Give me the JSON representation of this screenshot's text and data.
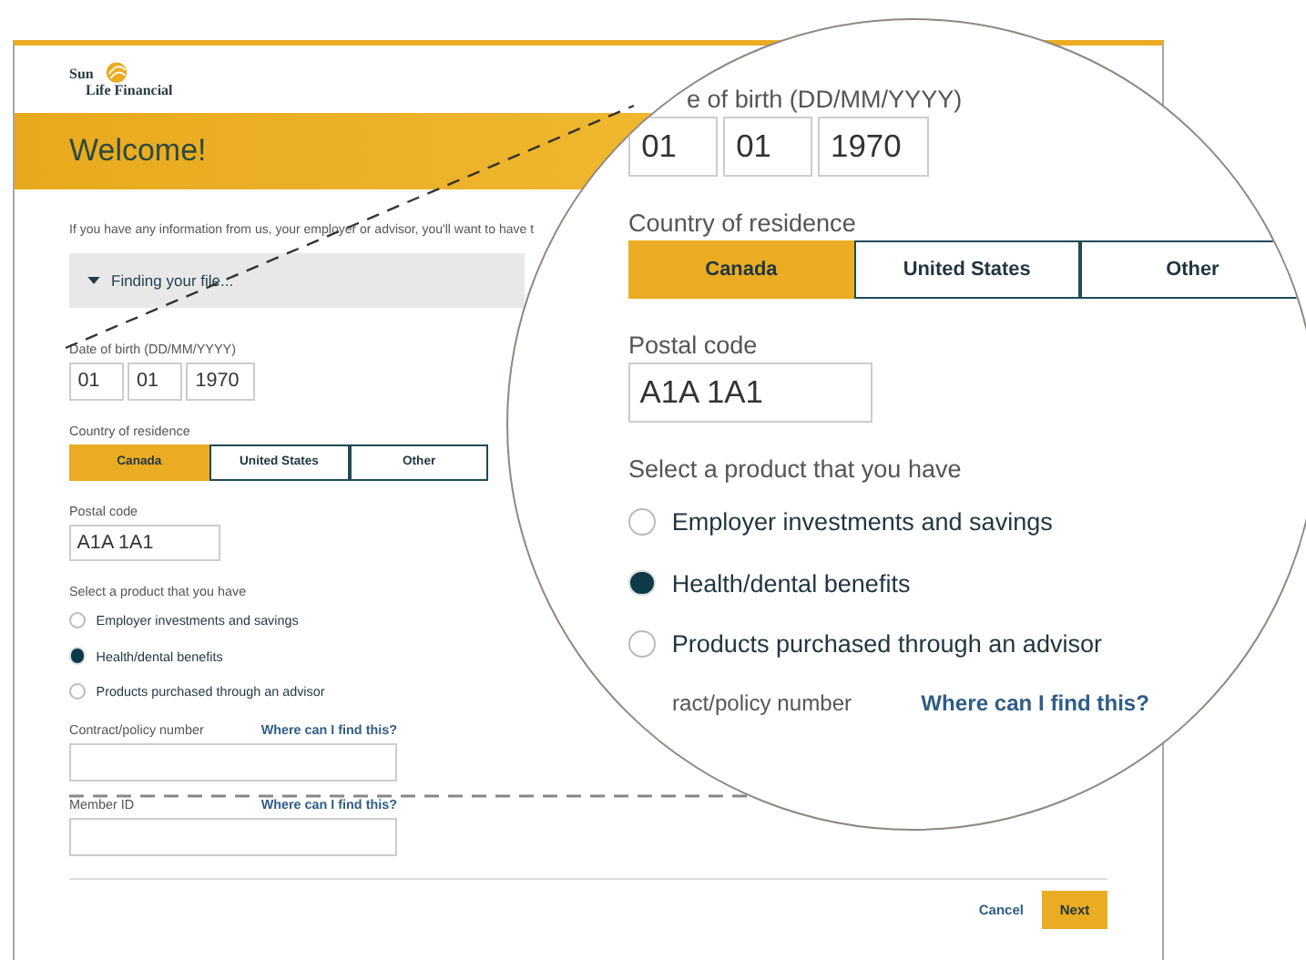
{
  "logo": {
    "line1": "Sun",
    "line2": "Life Financial"
  },
  "banner": {
    "title": "Welcome!"
  },
  "intro": "If you have any information from us, your employer or advisor, you'll want to have t",
  "finder": {
    "label": "Finding your file..."
  },
  "form": {
    "dob": {
      "label": "Date of birth (DD/MM/YYYY)",
      "fields": [
        "01",
        "01",
        "1970"
      ]
    },
    "country": {
      "label": "Country of residence",
      "options": [
        {
          "label": "Canada",
          "selected": true
        },
        {
          "label": "United States",
          "selected": false
        },
        {
          "label": "Other",
          "selected": false
        }
      ]
    },
    "postal": {
      "label": "Postal code",
      "value": "A1A 1A1"
    },
    "product": {
      "label": "Select a product that you have",
      "options": [
        {
          "label": "Employer investments and savings",
          "selected": false
        },
        {
          "label": "Health/dental benefits",
          "selected": true
        },
        {
          "label": "Products purchased through an advisor",
          "selected": false
        }
      ]
    },
    "contract": {
      "label": "Contract/policy number",
      "link": "Where can I find this?"
    },
    "member": {
      "label": "Member ID",
      "link": "Where can I find this?"
    }
  },
  "actions": {
    "cancel": "Cancel",
    "next": "Next"
  },
  "magnifier": {
    "dob": {
      "label": "e of birth (DD/MM/YYYY)",
      "fields": [
        "01",
        "01",
        "1970"
      ]
    },
    "country": {
      "label": "Country of residence",
      "options": [
        {
          "label": "Canada",
          "selected": true
        },
        {
          "label": "United States",
          "selected": false
        },
        {
          "label": "Other",
          "selected": false
        }
      ]
    },
    "postal": {
      "label": "Postal code",
      "value": "A1A 1A1"
    },
    "product": {
      "label": "Select a product that you have",
      "options": [
        {
          "label": "Employer investments and savings",
          "selected": false
        },
        {
          "label": "Health/dental benefits",
          "selected": true
        },
        {
          "label": "Products purchased through an advisor",
          "selected": false
        }
      ]
    },
    "contract": {
      "label": "ract/policy number",
      "link": "Where can I find this?"
    }
  }
}
